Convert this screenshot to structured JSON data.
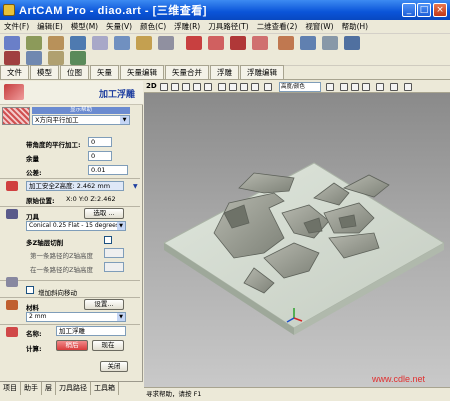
{
  "window": {
    "title": "ArtCAM Pro - diao.art - [三维查看]",
    "minimize_glyph": "_",
    "maximize_glyph": "□",
    "close_glyph": "×"
  },
  "menu": [
    "文件(F)",
    "编辑(E)",
    "模型(M)",
    "矢量(V)",
    "颜色(C)",
    "浮雕(R)",
    "刀具路径(T)",
    "二维查看(2)",
    "视窗(W)",
    "帮助(H)"
  ],
  "tabs": [
    "文件",
    "模型",
    "位图",
    "矢量",
    "矢量编辑",
    "矢量合并",
    "浮雕",
    "浮雕编辑"
  ],
  "panel": {
    "title": "加工浮雕",
    "strategy_header": "显示帮助",
    "strategy_value": "X方向平行加工",
    "stepover_label": "带角度的平行加工:",
    "stepover_value": "0",
    "tolerance_label": "余量",
    "tolerance_value": "0",
    "allowance_label": "公差:",
    "allowance_value": "0.01",
    "safe_z_label": "加工安全Z高度: 2.462 mm",
    "home_label": "原始位置:",
    "home_value": "X:0 Y:0 Z:2.462",
    "tool_label": "刀具",
    "tool_select_button": "选取 ...",
    "tool_value": "Conical 0.25 Flat - 15 degrees",
    "multi_z_label": "多Z轴层切削",
    "first_pass_label": "第一条路径的Z轴高度",
    "last_pass_label": "在一条路径的Z轴高度",
    "ramp_label": "增加斜向移动",
    "material_label": "材料",
    "material_setup_button": "设置...",
    "material_value": "2 mm",
    "name_label": "名称:",
    "name_value": "加工浮雕",
    "calc_label": "计算:",
    "later_button": "稍后",
    "now_button": "现在",
    "close_button": "关闭"
  },
  "bottom_tabs": [
    "项目",
    "助手",
    "层",
    "刀具路径",
    "工具箱"
  ],
  "view": {
    "mode_label": "2D",
    "height_combo": "高度/颜色"
  },
  "status_text": "寻求帮助，请按 F1",
  "watermark": "www.cdle.net",
  "colors": {
    "titlebar": "#0a54d8",
    "relief": "#9a9e96",
    "watermark": "#e03030"
  }
}
